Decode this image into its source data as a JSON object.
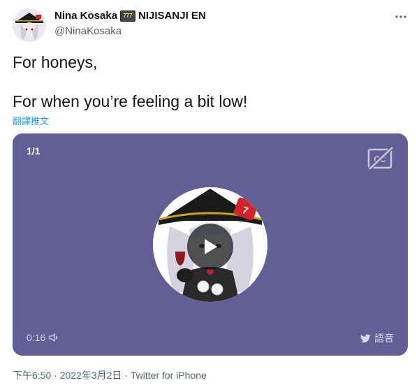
{
  "author": {
    "display_name": "Nina Kosaka",
    "emoji_text": "777",
    "affiliation": "NIJISANJI EN",
    "handle": "@NinaKosaka"
  },
  "tweet": {
    "line1": "For honeys,",
    "line2": "For when you’re feeling a bit low!",
    "translate_label": "翻譯推文"
  },
  "media": {
    "counter": "1/1",
    "duration": "0:16",
    "brand_label": "語音",
    "background_color": "#635f96"
  },
  "meta": {
    "time": "下午6:50",
    "separator": "·",
    "date": "2022年3月2日",
    "source": "Twitter for iPhone"
  },
  "icons": [
    "more-icon",
    "cc-icon",
    "play-icon",
    "speaker-icon",
    "twitter-bird-icon",
    "slot-machine-emoji"
  ]
}
